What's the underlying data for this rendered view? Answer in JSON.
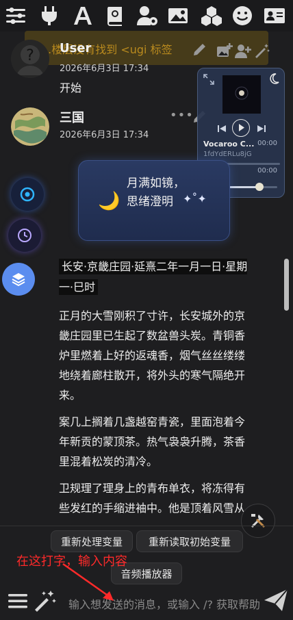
{
  "toolbar": {
    "icons": [
      "sliders-icon",
      "plug-icon",
      "font-icon",
      "book-gear-icon",
      "user-gear-icon",
      "images-icon",
      "cubes-icon",
      "smile-icon",
      "id-card-icon"
    ]
  },
  "toast": {
    "text": "...楼层没有找到 <ugi 标签"
  },
  "messages": [
    {
      "name": "User",
      "time": "2026年6月3日 17:34",
      "text": "开始"
    },
    {
      "name": "三国",
      "time": "2026年6月3日 17:34",
      "text": ""
    }
  ],
  "player": {
    "title": "Vocaroo C...",
    "id": "1fdYdERLu8jG",
    "time_current": "00:00",
    "time_total": "00:00",
    "volume": 0.7
  },
  "mood": {
    "text": "月满如镜，思绪澄明"
  },
  "story": {
    "heading": "长安·京畿庄园·延熹二年一月一日·星期一·巳时",
    "paragraphs": [
      "正月的大雪刚积了寸许，长安城外的京畿庄园里已生起了数盆兽头炭。青铜香炉里燃着上好的返魂香，烟气丝丝缕缕地绕着廊柱散开，将外头的寒气隔绝开来。",
      "案几上搁着几盏越窑青瓷，里面泡着今年新贡的蒙顶茶。热气袅袅升腾，茶香里混着松炭的清冷。",
      "卫规理了理身上的青布单衣，将冻得有些发红的手缩进袖中。他是顶着风雪从城里赶来的，鞋履上还沾"
    ]
  },
  "bottom": {
    "chip_reprocess": "重新处理变量",
    "chip_reread": "重新读取初始变量",
    "chip_audio": "音频播放器",
    "annotation": "在这打字，输入内容",
    "input_placeholder": "输入想发送的消息，或输入 /? 获取帮助"
  },
  "colors": {
    "annotation": "#ff2a2a",
    "card": "#24345a",
    "layers_button": "#5b8def"
  }
}
